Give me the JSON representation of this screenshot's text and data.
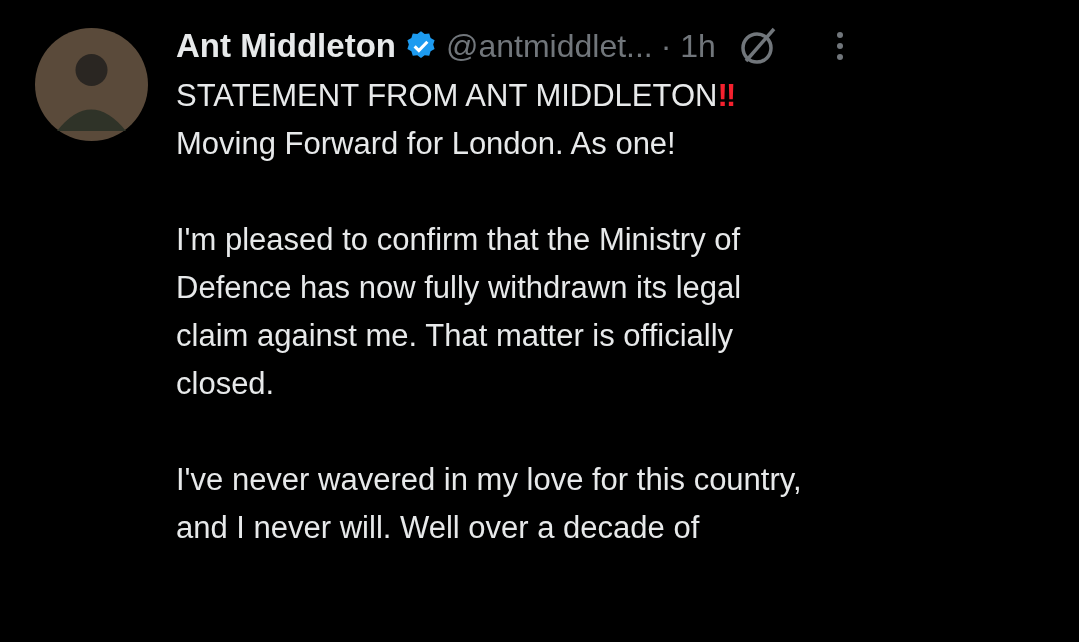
{
  "post": {
    "author": {
      "name": "Ant Middleton",
      "verified": true,
      "handle": "@antmiddlet...",
      "time": "· 1h"
    },
    "paragraphs": [
      {
        "lines": [
          {
            "text": "STATEMENT FROM ANT MIDDLETON",
            "mark": "‼"
          },
          {
            "text": "Moving Forward for London. As one!"
          }
        ]
      },
      {
        "lines": [
          {
            "text": "I'm pleased to confirm that the Ministry of"
          },
          {
            "text": "Defence has now fully withdrawn its legal"
          },
          {
            "text": "claim against me. That matter is officially"
          },
          {
            "text": "closed."
          }
        ]
      },
      {
        "lines": [
          {
            "text": "I've never wavered in my love for this country,"
          },
          {
            "text": "and I never will. Well over a decade of"
          }
        ]
      }
    ]
  }
}
